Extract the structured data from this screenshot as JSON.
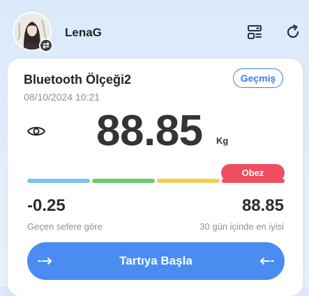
{
  "header": {
    "username": "LenaG"
  },
  "card": {
    "device_name": "Bluetooth Ölçeği2",
    "timestamp": "08/10/2024 10:21",
    "history_label": "Geçmiş",
    "weight_value": "88.85",
    "weight_unit": "Kg",
    "status_label": "Obez",
    "scale_colors": [
      "#7cc3ee",
      "#6cc872",
      "#f1cf55",
      "#ee4e60"
    ],
    "diff_value": "-0.25",
    "diff_label": "Geçen sefere göre",
    "best_value": "88.85",
    "best_label": "30 gün içinde en iyisi",
    "start_label": "Tartıya Başla"
  },
  "colors": {
    "accent": "#4a8cf0",
    "status_obese": "#ee4e60"
  },
  "icons": {
    "menu": "list-settings-icon",
    "refresh": "refresh-icon",
    "visibility": "eye-icon",
    "switch": "swap-icon"
  }
}
